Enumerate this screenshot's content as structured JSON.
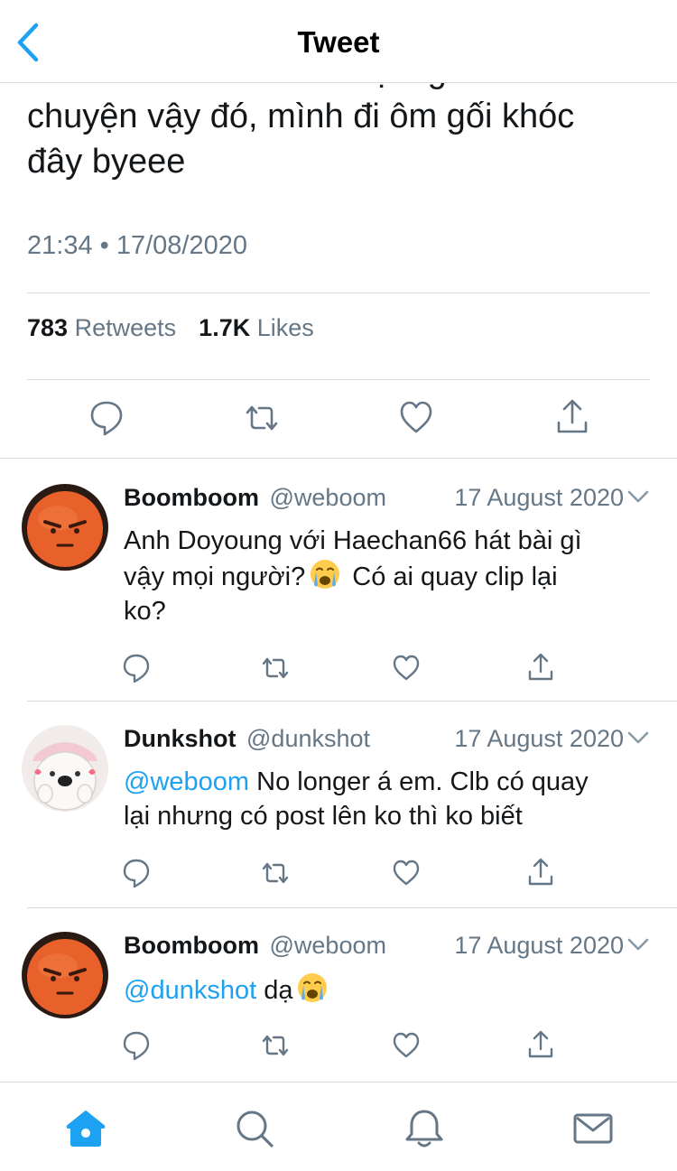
{
  "header": {
    "title": "Tweet",
    "back_icon": "chevron-left-icon"
  },
  "tweet": {
    "text_lines": [
      "luôn. Do mình kể để mọi người biết",
      "chuyện vậy đó, mình đi ôm gối khóc",
      "đây byeee"
    ],
    "time": "21:34 • 17/08/2020",
    "retweets_count": "783",
    "retweets_label": "Retweets",
    "likes_count": "1.7K",
    "likes_label": "Likes"
  },
  "replies": [
    {
      "name": "Boomboom",
      "handle": "@weboom",
      "date": "17 August 2020",
      "line1": "Anh Doyoung với Haechan66 hát bài gì",
      "line2_before": "vậy mọi người?",
      "line2_after": "Có ai quay clip lại",
      "line3": "ko?"
    },
    {
      "name": "Dunkshot",
      "handle": "@dunkshot",
      "date": "17 August 2020",
      "mention": "@weboom",
      "line1_rest": " No longer á em. Clb có quay",
      "line2": "lại nhưng có post lên ko thì ko biết"
    },
    {
      "name": "Boomboom",
      "handle": "@weboom",
      "date": "17 August 2020",
      "mention": "@dunkshot",
      "rest": " dạ"
    }
  ],
  "colors": {
    "accent": "#1da1f2",
    "secondary_text": "#657786",
    "primary_text": "#14171a",
    "divider": "#d7dadd"
  },
  "tabs": [
    "home-icon",
    "search-icon",
    "notifications-icon",
    "messages-icon"
  ]
}
